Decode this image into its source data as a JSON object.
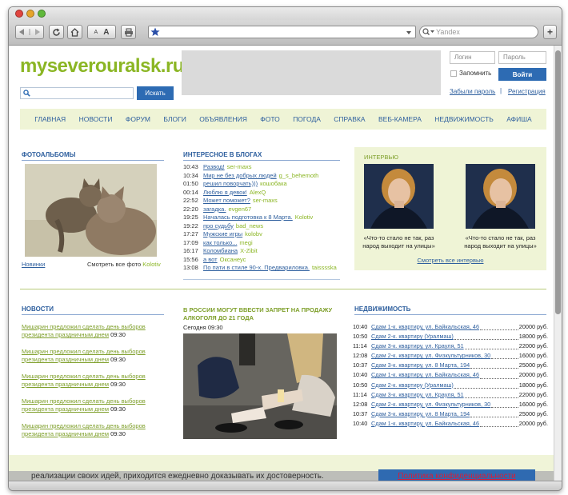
{
  "browser": {
    "search_engine": "Yandex",
    "text_small": "A",
    "text_large": "A",
    "add_tab": "+"
  },
  "header": {
    "logo": "myseverouralsk.ru",
    "search_button": "Искать",
    "login_placeholder": "Логин",
    "password_placeholder": "Пароль",
    "remember_label": "Запомнить",
    "login_button": "Войти",
    "forgot_link": "Забыли пароль",
    "separator": "|",
    "register_link": "Регистрация"
  },
  "nav": [
    "ГЛАВНАЯ",
    "НОВОСТИ",
    "ФОРУМ",
    "БЛОГИ",
    "ОБЪЯВЛЕНИЯ",
    "ФОТО",
    "ПОГОДА",
    "СПРАВКА",
    "ВЕБ-КАМЕРА",
    "НЕДВИЖИМОСТЬ",
    "АФИША"
  ],
  "photo_albums": {
    "title": "ФОТОАЛЬБОМЫ",
    "new_link": "Новинки",
    "all_text": "Смотреть все фото",
    "author": "Kolotiv"
  },
  "blogs": {
    "title": "ИНТЕРЕСНОЕ В БЛОГАХ",
    "items": [
      {
        "time": "10:43",
        "title": "Развод!",
        "author": "ser-maxs"
      },
      {
        "time": "10:34",
        "title": "Мир не без добрых людей",
        "author": "g_s_behemoth"
      },
      {
        "time": "01:50",
        "title": "решил поворчать)))",
        "author": "кошобака"
      },
      {
        "time": "00:14",
        "title": "Люблю я девок!",
        "author": "AlexQ"
      },
      {
        "time": "22:52",
        "title": "Может поможет?",
        "author": "ser-maxs"
      },
      {
        "time": "22:20",
        "title": "загадка.",
        "author": "evgen67"
      },
      {
        "time": "19:25",
        "title": "Началась подготовка к 8 Марта.",
        "author": "Kolotiv"
      },
      {
        "time": "19:22",
        "title": "про судьбу",
        "author": "bad_news"
      },
      {
        "time": "17:27",
        "title": "Мужские игры",
        "author": "kolobv"
      },
      {
        "time": "17:09",
        "title": "как только...",
        "author": "megi"
      },
      {
        "time": "16:17",
        "title": "Коломбиана",
        "author": "X-Zibit"
      },
      {
        "time": "15:56",
        "title": "а вот",
        "author": "Оксанеус"
      },
      {
        "time": "13:08",
        "title": "По пати в стиле 90-х. Предвариловка.",
        "author": "taisssska"
      }
    ]
  },
  "interview": {
    "title": "ИНТЕРВЬЮ",
    "items": [
      {
        "caption": "«Что-то стало не так, раз народ выходит на улицы»"
      },
      {
        "caption": "«Что-то стало не так, раз народ выходит на улицы»"
      }
    ],
    "all_link": "Смотреть все интервью"
  },
  "news": {
    "title": "НОВОСТИ",
    "items": [
      {
        "text": "Мишарин предложил сделать день выборов президента праздничным днем",
        "time": "09:30"
      },
      {
        "text": "Мишарин предложил сделать день выборов президента праздничным днем",
        "time": "09:30"
      },
      {
        "text": "Мишарин предложил сделать день выборов президента праздничным днем",
        "time": "09:30"
      },
      {
        "text": "Мишарин предложил сделать день выборов президента праздничным днем",
        "time": "09:30"
      },
      {
        "text": "Мишарин предложил сделать день выборов президента праздничным днем",
        "time": "09:30"
      }
    ]
  },
  "article": {
    "title": "В РОССИИ МОГУТ ВВЕСТИ ЗАПРЕТ НА ПРОДАЖУ АЛКОГОЛЯ ДО 21 ГОДА",
    "date": "Сегодня 09:30"
  },
  "realty": {
    "title": "НЕДВИЖИМОСТЬ",
    "items": [
      {
        "time": "10:40",
        "text": "Сдам 1-к. квартиру, ул. Байкальская, 46",
        "price": "20000 руб."
      },
      {
        "time": "10:50",
        "text": "Сдам 2-к. квартиру (Уралмаш)",
        "price": "18000 руб."
      },
      {
        "time": "11:14",
        "text": "Сдам 3-к. квартиру, ул. Крауля, 51",
        "price": "22000 руб."
      },
      {
        "time": "12:08",
        "text": "Сдам 2-к. квартиру, ул. Физкультурников, 30",
        "price": "16000 руб."
      },
      {
        "time": "10:37",
        "text": "Сдам 3-к. квартиру, ул. 8 Марта, 194",
        "price": "25000 руб."
      },
      {
        "time": "10:40",
        "text": "Сдам 1-к. квартиру, ул. Байкальская, 46",
        "price": "20000 руб."
      },
      {
        "time": "10:50",
        "text": "Сдам 2-к. квартиру (Уралмаш)",
        "price": "18000 руб."
      },
      {
        "time": "11:14",
        "text": "Сдам 3-к. квартиру, ул. Крауля, 51",
        "price": "22000 руб."
      },
      {
        "time": "12:08",
        "text": "Сдам 2-к. квартиру, ул. Физкультурников, 30",
        "price": "16000 руб."
      },
      {
        "time": "10:37",
        "text": "Сдам 3-к. квартиру, ул. 8 Марта, 194",
        "price": "25000 руб."
      },
      {
        "time": "10:40",
        "text": "Сдам 1-к. квартиру, ул. Байкальская, 46",
        "price": "20000 руб."
      }
    ]
  },
  "footer": {
    "text": "реализации своих идей, приходится ежедневно доказывать их достоверность.",
    "privacy_link": "Политика конфиденциальности"
  },
  "colors": {
    "logo_green": "#8bb624",
    "link_blue": "#2e5f9e",
    "button_blue": "#2d6bb3",
    "nav_bg": "#eff4d6",
    "privacy_red": "#d51e3a"
  }
}
